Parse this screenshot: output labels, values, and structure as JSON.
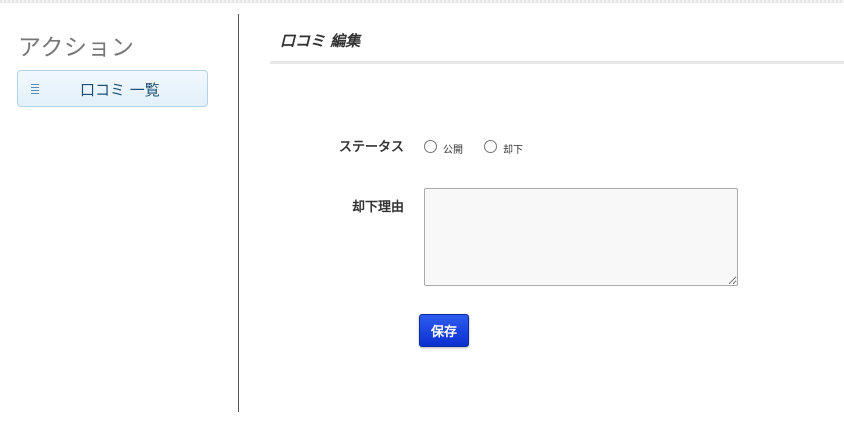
{
  "sidebar": {
    "title": "アクション",
    "items": [
      {
        "label": "口コミ 一覧",
        "icon": "list-icon"
      }
    ]
  },
  "main": {
    "title": "口コミ 編集"
  },
  "form": {
    "status_label": "ステータス",
    "status_options": [
      {
        "label": "公開",
        "checked": false
      },
      {
        "label": "却下",
        "checked": false
      }
    ],
    "reason_label": "却下理由",
    "reason_value": "",
    "save_label": "保存"
  },
  "colors": {
    "button": "#1a3fe0",
    "sidebar_item_border": "#b5d3ea",
    "sidebar_item_bg": "#e8f3fb"
  }
}
